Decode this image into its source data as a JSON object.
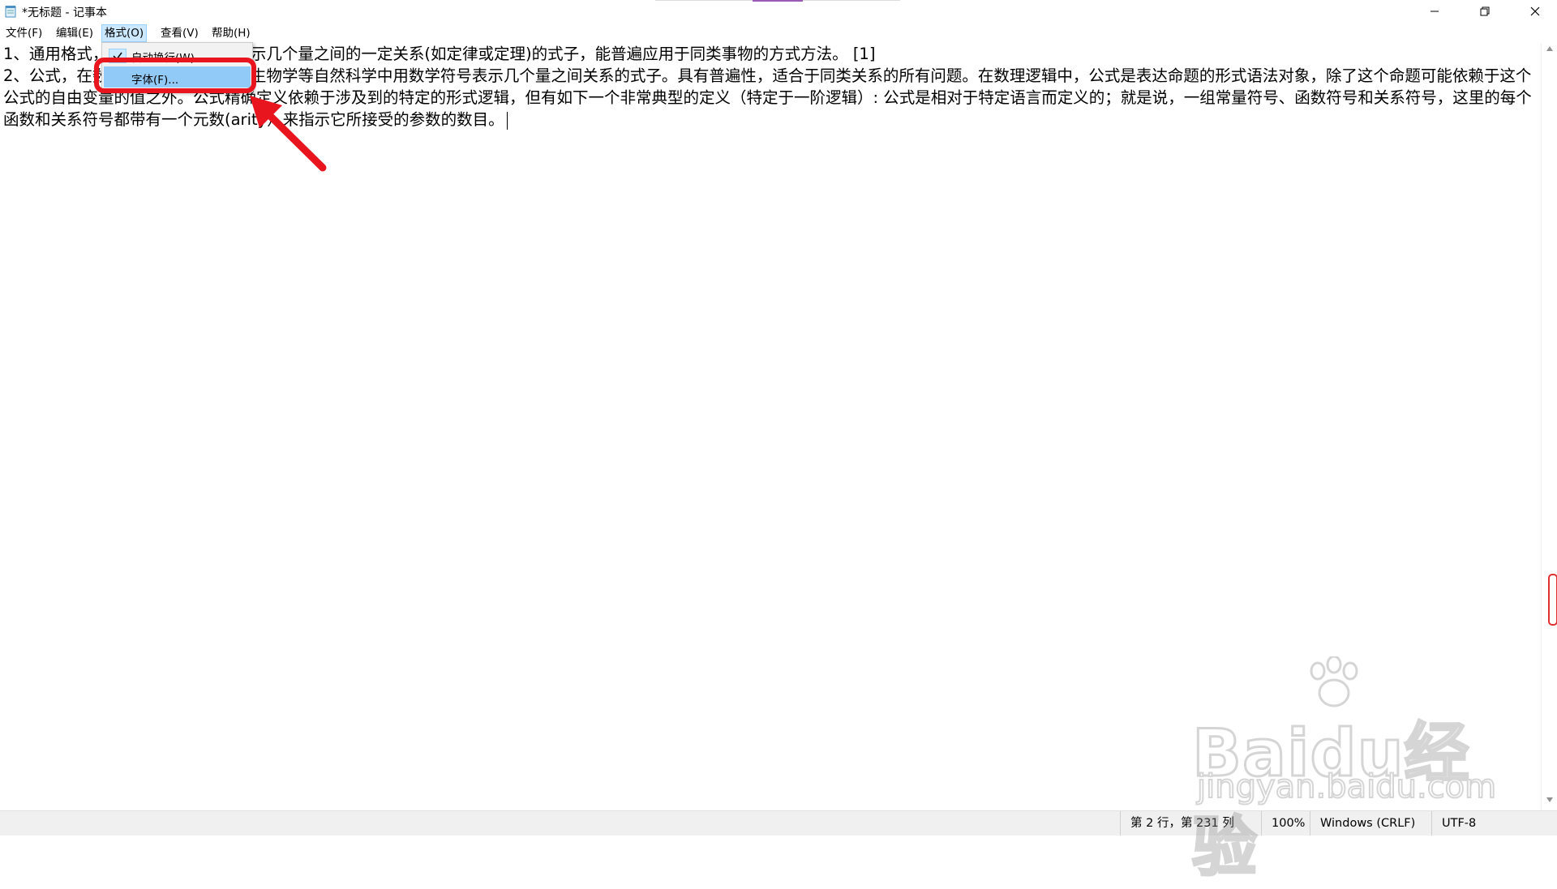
{
  "window": {
    "title": "*无标题 - 记事本"
  },
  "menubar": {
    "items": [
      {
        "label": "文件(F)"
      },
      {
        "label": "编辑(E)"
      },
      {
        "label": "格式(O)"
      },
      {
        "label": "查看(V)"
      },
      {
        "label": "帮助(H)"
      }
    ]
  },
  "format_menu": {
    "word_wrap_label": "自动换行(W)",
    "word_wrap_checked": true,
    "font_label": "字体(F)..."
  },
  "editor": {
    "lines": [
      "1、通用格式，数学中用数学符号表示几个量之间的一定关系(如定律或定理)的式子，能普遍应用于同类事物的方式方法。 [1]",
      "2、公式，在数学、物理学、化学、生物学等自然科学中用数学符号表示几个量之间关系的式子。具有普遍性，适合于同类关系的所有问题。在数理逻辑中，公式是表达命题的形式语法对象，除了这个命题可能依赖于这个公式的自由变量的值之外。公式精确定义依赖于涉及到的特定的形式逻辑，但有如下一个非常典型的定义（特定于一阶逻辑）: 公式是相对于特定语言而定义的；就是说，一组常量符号、函数符号和关系符号，这里的每个函数和关系符号都带有一个元数(arity）来指示它所接受的参数的数目。"
    ]
  },
  "statusbar": {
    "position": "第 2 行，第 231 列",
    "zoom": "100%",
    "line_ending": "Windows (CRLF)",
    "encoding": "UTF-8"
  },
  "watermark": {
    "brand": "Baidu经验",
    "url": "jingyan.baidu.com"
  },
  "colors": {
    "menu_highlight": "#cce8ff",
    "selected_item": "#91c9f7",
    "annotation_red": "#e8151f"
  }
}
